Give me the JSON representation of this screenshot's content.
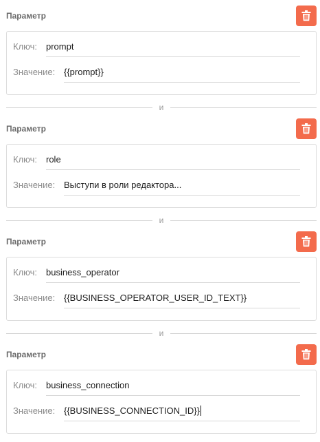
{
  "colors": {
    "delete_button": "#f36b4c",
    "border": "#dcdcdc"
  },
  "params": [
    {
      "title": "Параметр",
      "key_label": "Ключ:",
      "key": "prompt",
      "value_label": "Значение:",
      "value": "{{prompt}}",
      "delete_icon": "trash-icon"
    },
    {
      "title": "Параметр",
      "key_label": "Ключ:",
      "key": "role",
      "value_label": "Значение:",
      "value": "Выступи в роли редактора...",
      "delete_icon": "trash-icon"
    },
    {
      "title": "Параметр",
      "key_label": "Ключ:",
      "key": "business_operator",
      "value_label": "Значение:",
      "value": "{{BUSINESS_OPERATOR_USER_ID_TEXT}}",
      "delete_icon": "trash-icon"
    },
    {
      "title": "Параметр",
      "key_label": "Ключ:",
      "key": "business_connection",
      "value_label": "Значение:",
      "value": "{{BUSINESS_CONNECTION_ID}}",
      "delete_icon": "trash-icon"
    }
  ],
  "separators": [
    "и",
    "и",
    "и"
  ]
}
